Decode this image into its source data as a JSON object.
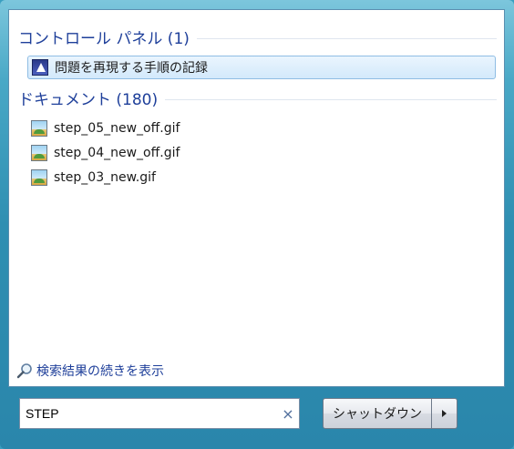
{
  "groups": [
    {
      "title": "コントロール パネル (1)",
      "items": [
        {
          "label": "問題を再現する手順の記録",
          "icon": "steps-recorder-icon",
          "selected": true
        }
      ]
    },
    {
      "title": "ドキュメント (180)",
      "items": [
        {
          "label": "step_05_new_off.gif",
          "icon": "image-file-icon"
        },
        {
          "label": "step_04_new_off.gif",
          "icon": "image-file-icon"
        },
        {
          "label": "step_03_new.gif",
          "icon": "image-file-icon"
        }
      ]
    }
  ],
  "see_more": {
    "label": "検索結果の続きを表示",
    "icon": "magnifier-icon"
  },
  "search": {
    "value": "STEP",
    "clear_glyph": "×"
  },
  "shutdown": {
    "label": "シャットダウン",
    "arrow_icon": "triangle-right-icon"
  },
  "colors": {
    "accent_text": "#1e3f9a",
    "selection_border": "#8fbde4",
    "frame": "#2f8fb2"
  }
}
